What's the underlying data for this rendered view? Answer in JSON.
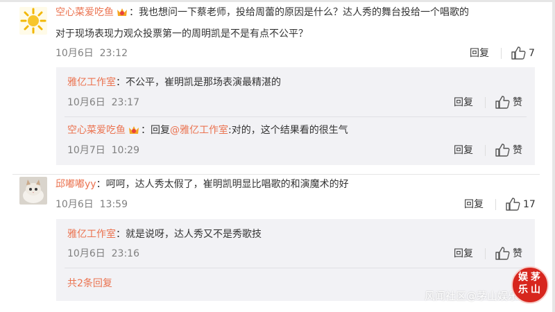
{
  "colors": {
    "accent": "#eb7350",
    "meta": "#808080",
    "reply_bg": "#f2f2f5"
  },
  "comments": [
    {
      "user": "空心菜爱吃鱼",
      "text_line1": "：我也想问一下蔡老师，投给周蕾的原因是什么？达人秀的舞台投给一个唱歌的",
      "text_line2": "对于现场表现力观众投票第一的周明凯是不是有点不公平？",
      "date": "10月6日",
      "time": "23:12",
      "reply_label": "回复",
      "likes": "7",
      "replies": [
        {
          "user": "雅亿工作室",
          "text": "：不公平，崔明凯是那场表演最精湛的",
          "date": "10月6日",
          "time": "23:17",
          "reply_label": "回复",
          "like_label": "赞"
        },
        {
          "user": "空心菜爱吃鱼",
          "text_prefix": "：回复",
          "mention": "@雅亿工作室",
          "text_suffix": ":对的，这个结果看的很生气",
          "date": "10月7日",
          "time": "10:29",
          "reply_label": "回复",
          "like_label": "赞"
        }
      ]
    },
    {
      "user": "邱嘟嘟yy",
      "text_line1": "：呵呵，达人秀太假了，崔明凯明显比唱歌的和演魔术的好",
      "date": "10月6日",
      "time": "13:59",
      "reply_label": "回复",
      "likes": "17",
      "replies": [
        {
          "user": "雅亿工作室",
          "text": "：就是说呀，达人秀又不是秀歌技",
          "date": "10月6日",
          "time": "23:16",
          "reply_label": "回复",
          "like_label": "赞"
        }
      ],
      "more_link": "共2条回复"
    }
  ],
  "watermark": {
    "text": "风闻社区@茅山娱乐",
    "stamp_chars": [
      "娱",
      "乐",
      "茅",
      "山"
    ]
  },
  "icons": {
    "thumb": "thumbs-up-icon",
    "vip": "vip-crown-badge-icon"
  }
}
